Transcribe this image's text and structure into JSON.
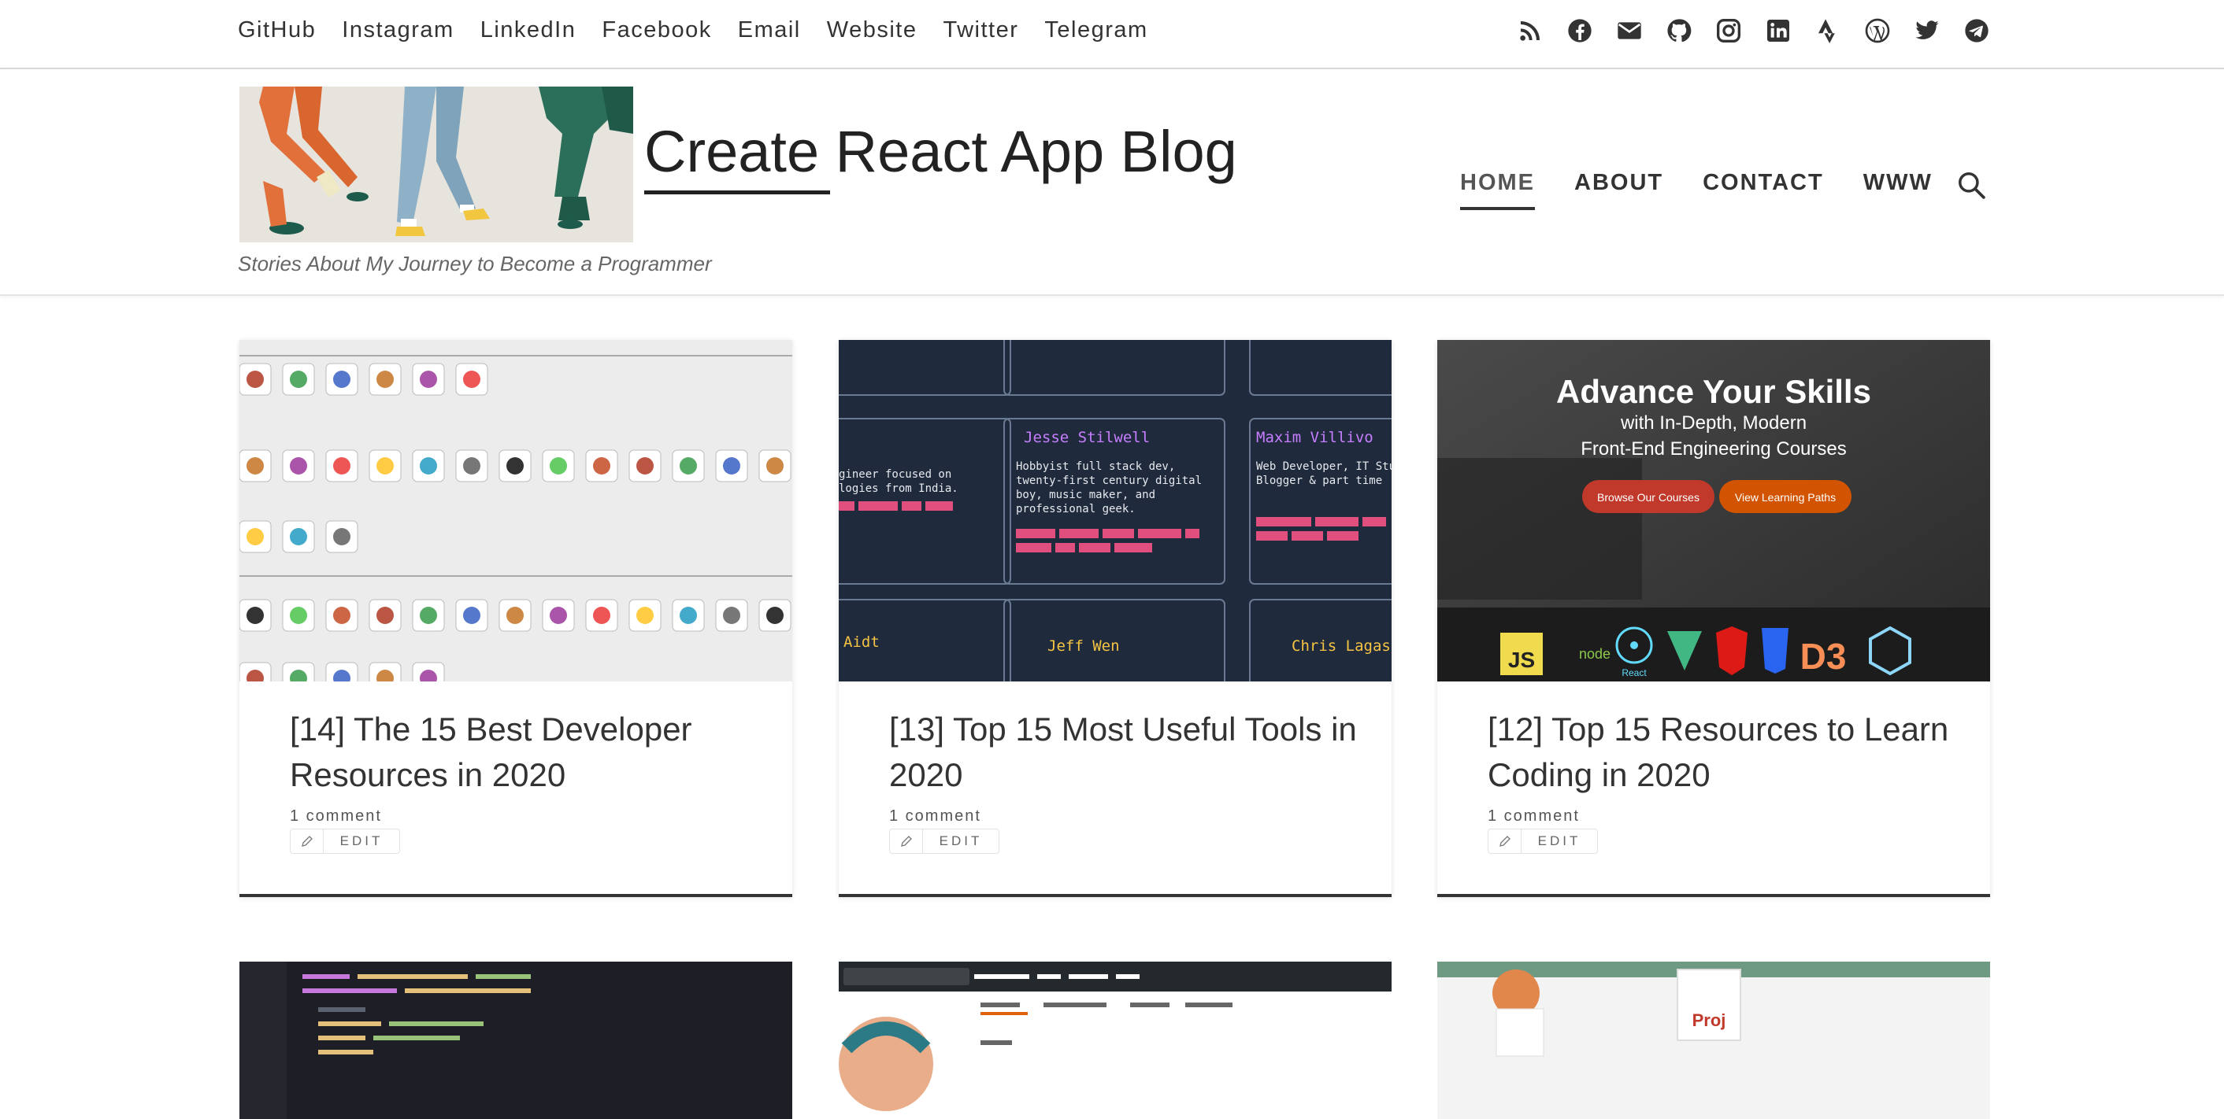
{
  "topbar": {
    "links": [
      "GitHub",
      "Instagram",
      "LinkedIn",
      "Facebook",
      "Email",
      "Website",
      "Twitter",
      "Telegram"
    ],
    "social_icons": [
      "rss-icon",
      "facebook-icon",
      "email-icon",
      "github-icon",
      "instagram-icon",
      "linkedin-icon",
      "strava-icon",
      "wordpress-icon",
      "twitter-icon",
      "telegram-icon"
    ]
  },
  "header": {
    "site_title": "Create React App Blog",
    "tagline": "Stories About My Journey to Become a Programmer",
    "nav": [
      "HOME",
      "ABOUT",
      "CONTACT",
      "WWW"
    ],
    "active_nav": "HOME"
  },
  "posts": [
    {
      "title": "[14] The 15 Best Developer Resources in 2020",
      "comments": "1 comment",
      "edit": "EDIT"
    },
    {
      "title": "[13] Top 15 Most Useful Tools in 2020",
      "comments": "1 comment",
      "edit": "EDIT"
    },
    {
      "title": "[12] Top 15 Resources to Learn Coding in 2020",
      "comments": "1 comment",
      "edit": "EDIT"
    }
  ],
  "thumb3": {
    "headline": "Advance Your Skills",
    "sub1": "with In-Depth, Modern",
    "sub2": "Front-End Engineering Courses",
    "btn1": "Browse Our Courses",
    "btn2": "View Learning Paths"
  },
  "thumb2": {
    "names": [
      "Jesse Stilwell",
      "Maxim Villivo",
      "Jeff Wen",
      "Chris Lagasse",
      "Aidt"
    ]
  },
  "colors": {
    "accent": "#333333",
    "nav_active": "#333333"
  }
}
